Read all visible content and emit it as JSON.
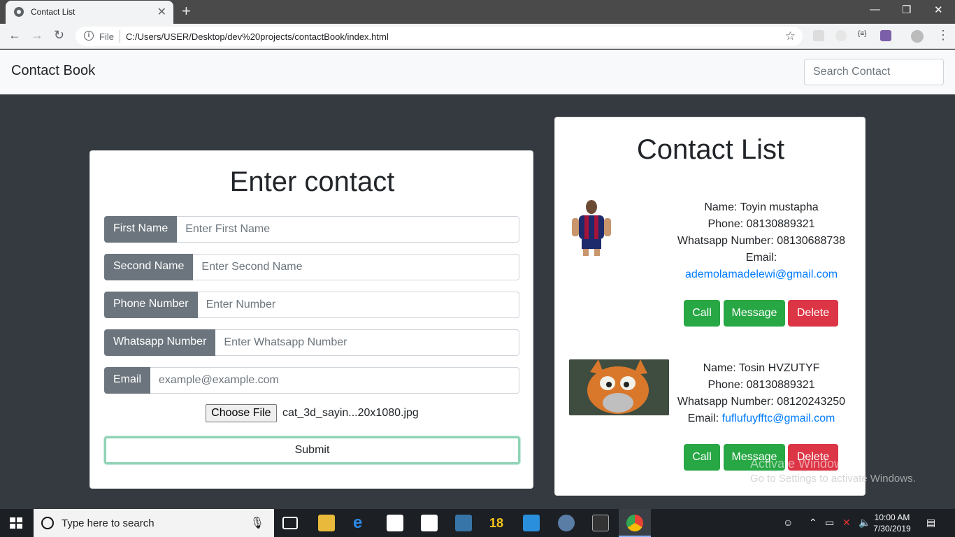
{
  "browser": {
    "tab_title": "Contact List",
    "tab_close": "✕",
    "new_tab": "+",
    "scheme": "File",
    "url": "C:/Users/USER/Desktop/dev%20projects/contactBook/index.html",
    "window_controls": [
      "—",
      "❐",
      "✕"
    ]
  },
  "navbar": {
    "brand": "Contact Book",
    "search_placeholder": "Search Contact"
  },
  "form": {
    "heading": "Enter contact",
    "fields": [
      {
        "label": "First Name",
        "placeholder": "Enter First Name"
      },
      {
        "label": "Second Name",
        "placeholder": "Enter Second Name"
      },
      {
        "label": "Phone Number",
        "placeholder": "Enter Number"
      },
      {
        "label": "Whatsapp Number",
        "placeholder": "Enter Whatsapp Number"
      },
      {
        "label": "Email",
        "placeholder": "example@example.com"
      }
    ],
    "choose_file": "Choose File",
    "file_name": "cat_3d_sayin...20x1080.jpg",
    "submit": "Submit"
  },
  "list": {
    "heading": "Contact List",
    "contacts": [
      {
        "name": "Name: Toyin mustapha",
        "phone": "Phone: 08130889321",
        "whatsapp": "Whatsapp Number: 08130688738",
        "email_label": "Email:",
        "email": "ademolamadelewi@gmail.com",
        "call": "Call",
        "message": "Message",
        "delete": "Delete"
      },
      {
        "name": "Name: Tosin HVZUTYF",
        "phone": "Phone: 08130889321",
        "whatsapp": "Whatsapp Number: 08120243250",
        "email_label": "Email:",
        "email": "fuflufuyfftc@gmail.com",
        "call": "Call",
        "message": "Message",
        "delete": "Delete"
      }
    ]
  },
  "watermark": {
    "line1": "Activate Windows",
    "line2": "Go to Settings to activate Windows."
  },
  "taskbar": {
    "search_text": "Type here to search",
    "time": "10:00 AM",
    "date": "7/30/2019",
    "badge": "18"
  }
}
